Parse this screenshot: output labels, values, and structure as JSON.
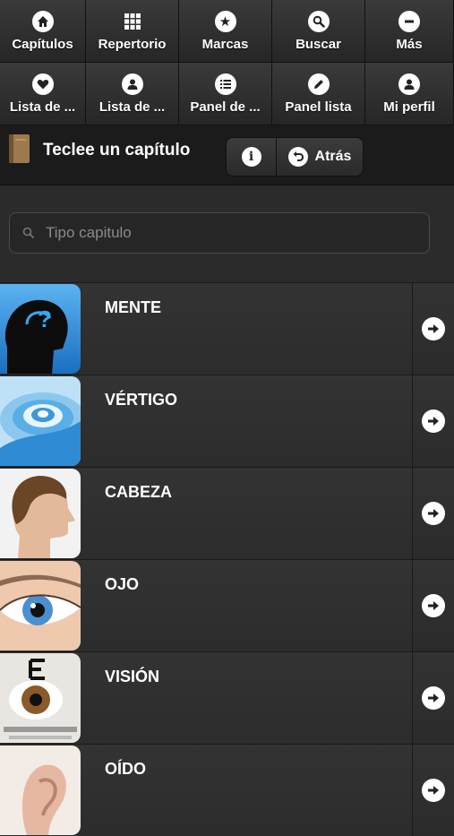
{
  "nav": {
    "items": [
      {
        "label": "Capítulos",
        "icon": "home-icon"
      },
      {
        "label": "Repertorio",
        "icon": "grid-icon"
      },
      {
        "label": "Marcas",
        "icon": "star-icon"
      },
      {
        "label": "Buscar",
        "icon": "search-icon"
      },
      {
        "label": "Más",
        "icon": "minus-icon"
      },
      {
        "label": "Lista de ...",
        "icon": "heart-icon"
      },
      {
        "label": "Lista de ...",
        "icon": "user-icon"
      },
      {
        "label": "Panel de ...",
        "icon": "list-icon"
      },
      {
        "label": "Panel lista",
        "icon": "pencil-icon"
      },
      {
        "label": "Mi perfil",
        "icon": "user-icon"
      }
    ]
  },
  "header": {
    "title": "Teclee un capítulo",
    "info_icon": "info-icon",
    "back_label": "Atrás"
  },
  "search": {
    "placeholder": "Tipo capitulo",
    "value": ""
  },
  "chapters": [
    {
      "label": "MENTE",
      "image": "head-question-image"
    },
    {
      "label": "VÉRTIGO",
      "image": "spiral-image"
    },
    {
      "label": "CABEZA",
      "image": "head-profile-image"
    },
    {
      "label": "OJO",
      "image": "eye-image"
    },
    {
      "label": "VISIÓN",
      "image": "eye-chart-image"
    },
    {
      "label": "OÍDO",
      "image": "ear-image"
    }
  ],
  "colors": {
    "background": "#2a2a2a",
    "nav_background": "#1e1e1e",
    "text": "#ffffff"
  }
}
